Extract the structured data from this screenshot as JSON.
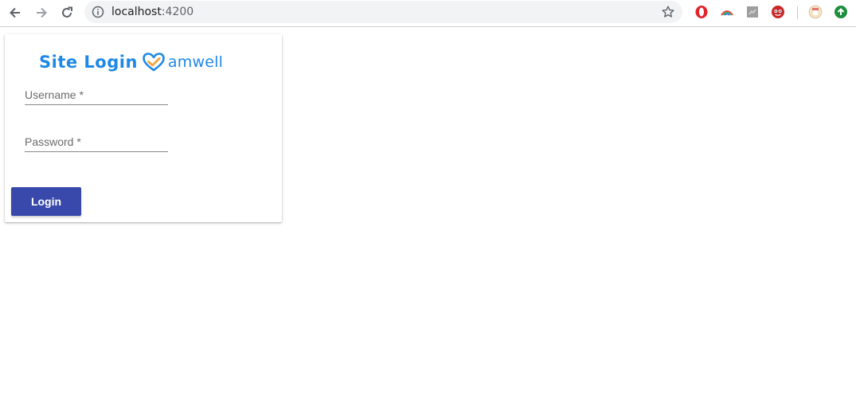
{
  "browser": {
    "url_host": "localhost",
    "url_port": ":4200",
    "icons": {
      "back": "back-arrow-icon",
      "forward": "forward-arrow-icon",
      "reload": "reload-icon",
      "info": "info-icon",
      "bookmark": "star-icon"
    },
    "extensions": [
      "opera-extension-icon",
      "rainbow-extension-icon",
      "gray-extension-icon",
      "red-monster-extension-icon",
      "avatar-extension-icon",
      "green-upload-extension-icon"
    ]
  },
  "login": {
    "title": "Site Login",
    "brand": "amwell",
    "username_label": "Username *",
    "password_label": "Password *",
    "username_value": "",
    "password_value": "",
    "button_label": "Login"
  },
  "colors": {
    "brand_blue": "#1e88e5",
    "heart_orange": "#f4a23c",
    "button_indigo": "#3949ab"
  }
}
